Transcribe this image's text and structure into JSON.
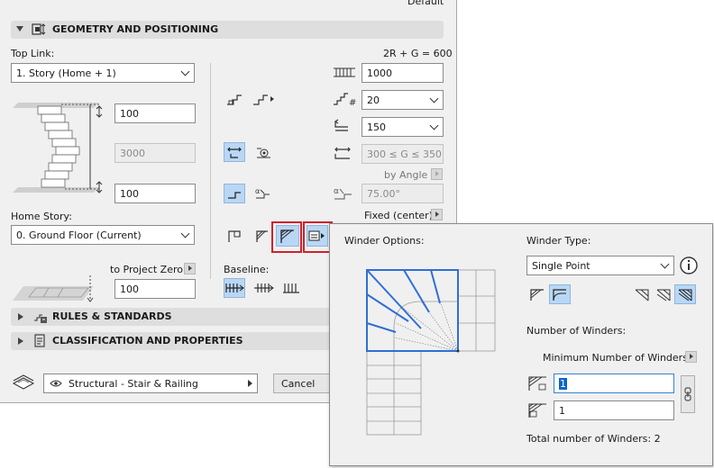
{
  "header": {
    "default_label": "Default"
  },
  "geometry": {
    "section_title": "GEOMETRY AND POSITIONING",
    "formula": "2R + G = 600",
    "top_link_label": "Top Link:",
    "top_link_value": "1. Story (Home + 1)",
    "top_offset": "100",
    "height_value": "3000",
    "bottom_offset": "100",
    "home_story_label": "Home Story:",
    "home_story_value": "0. Ground Floor (Current)",
    "to_project_zero_label": "to Project Zero",
    "project_zero_value": "100",
    "flight_width": "1000",
    "riser_count": "20",
    "tread_depth": "150",
    "going_range": "300 ≤ G ≤ 350",
    "by_angle_label": "by Angle",
    "angle_value": "75.00°",
    "fixed_label": "Fixed (center)",
    "baseline_label": "Baseline:"
  },
  "sections": [
    {
      "title": "RULES & STANDARDS"
    },
    {
      "title": "CLASSIFICATION AND PROPERTIES"
    }
  ],
  "footer": {
    "favorite_value": "Structural - Stair & Railing",
    "cancel_label": "Cancel"
  },
  "winder": {
    "options_label": "Winder Options:",
    "type_label": "Winder Type:",
    "type_value": "Single Point",
    "number_label": "Number of Winders:",
    "min_label": "Minimum Number of Winders",
    "count_first": "1",
    "count_second": "1",
    "total_label": "Total number of Winders: 2"
  },
  "colors": {
    "accent": "#2f6fd6",
    "highlight": "#b9d7f5",
    "callout": "#d0222a"
  }
}
